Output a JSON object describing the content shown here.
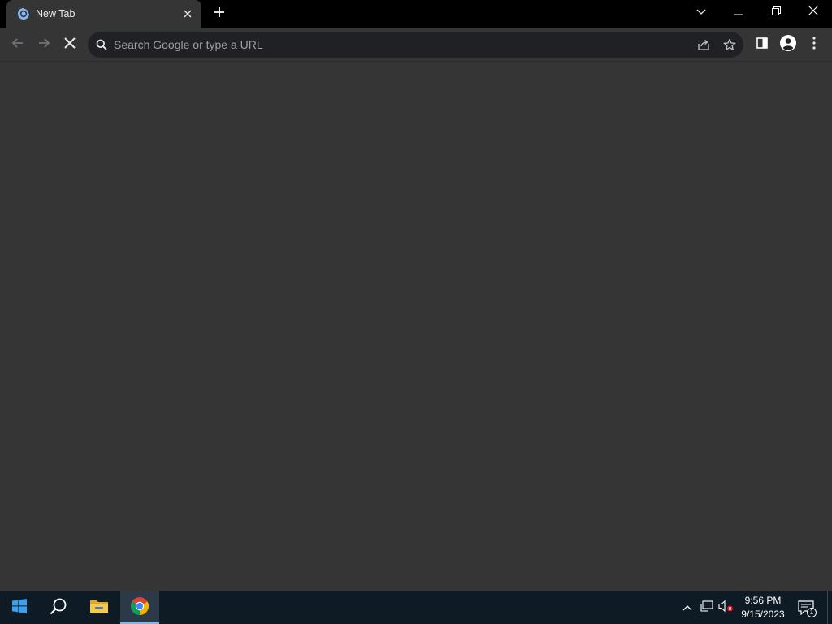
{
  "browser": {
    "tab": {
      "title": "New Tab",
      "favicon": "chrome-loading-icon"
    },
    "new_tab_icon": "plus-icon",
    "window_controls": [
      "tab-search-icon",
      "minimize-icon",
      "restore-icon",
      "close-icon"
    ],
    "toolbar": {
      "back_icon": "arrow-left-icon",
      "forward_icon": "arrow-right-icon",
      "stop_icon": "close-icon",
      "omnibox": {
        "value": "",
        "placeholder": "Search Google or type a URL",
        "search_icon": "search-icon"
      },
      "share_icon": "share-icon",
      "bookmark_icon": "star-icon",
      "side_panel_icon": "side-panel-icon",
      "profile_icon": "avatar-icon",
      "menu_icon": "kebab-menu-icon"
    }
  },
  "taskbar": {
    "apps": [
      "windows-start-icon",
      "search-icon",
      "file-explorer-icon",
      "chrome-icon"
    ],
    "active_app": "chrome-icon",
    "tray": [
      "chevron-up-icon",
      "network-icon",
      "volume-muted-icon"
    ],
    "clock": {
      "time": "9:56 PM",
      "date": "9/15/2023"
    },
    "notification_count": "1"
  },
  "colors": {
    "titlebar": "#000000",
    "tab_active": "#353535",
    "omnibox": "#202124",
    "page_background": "#353535",
    "taskbar": "#0e1a24",
    "accent": "#76b9ed"
  }
}
